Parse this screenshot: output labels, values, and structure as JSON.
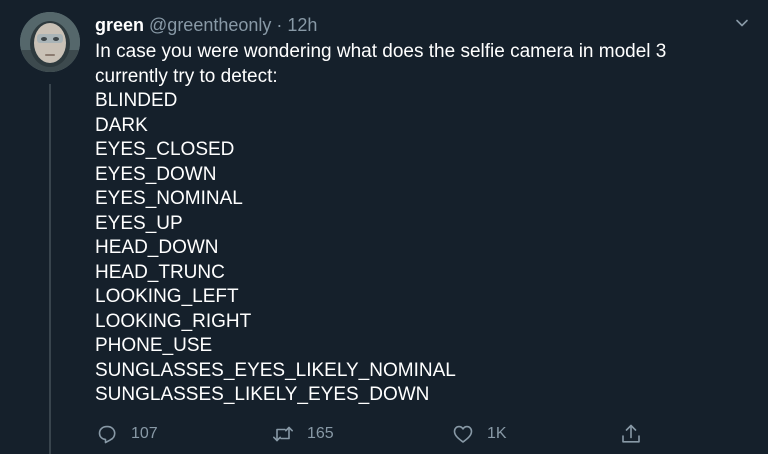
{
  "tweet": {
    "display_name": "green",
    "handle": "@greentheonly",
    "separator": "·",
    "time": "12h",
    "intro": "In case you were wondering what does the selfie camera in model 3 currently try to detect:",
    "states": [
      "BLINDED",
      "DARK",
      "EYES_CLOSED",
      "EYES_DOWN",
      "EYES_NOMINAL",
      "EYES_UP",
      "HEAD_DOWN",
      "HEAD_TRUNC",
      "LOOKING_LEFT",
      "LOOKING_RIGHT",
      "PHONE_USE",
      "SUNGLASSES_EYES_LIKELY_NOMINAL",
      "SUNGLASSES_LIKELY_EYES_DOWN"
    ],
    "actions": {
      "reply_count": "107",
      "retweet_count": "165",
      "like_count": "1K"
    }
  },
  "icons": {
    "caret": "chevron-down-icon",
    "reply": "reply-icon",
    "retweet": "retweet-icon",
    "like": "heart-icon",
    "share": "share-icon"
  },
  "colors": {
    "background": "#15202b",
    "text_primary": "#ffffff",
    "text_secondary": "#8899a6",
    "divider": "#38444d"
  }
}
